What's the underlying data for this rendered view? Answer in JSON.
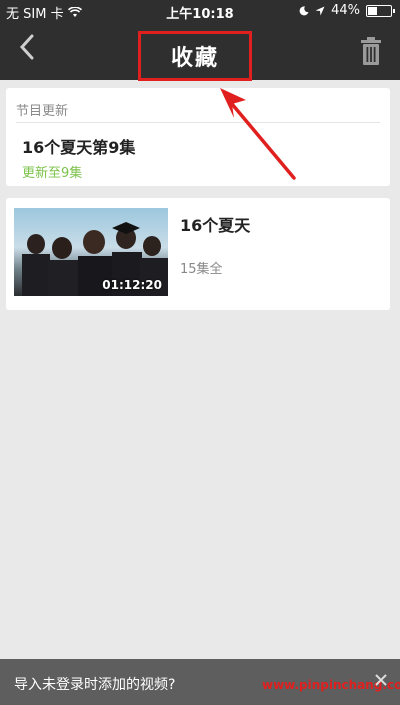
{
  "status_bar": {
    "carrier": "无 SIM 卡",
    "time": "上午10:18",
    "battery_text": "44%",
    "battery_level": 0.44
  },
  "nav": {
    "title": "收藏"
  },
  "updates": {
    "section_label": "节目更新",
    "show_title": "16个夏天第9集",
    "update_tag": "更新至9集"
  },
  "favorites": [
    {
      "title": "16个夏天",
      "episodes": "15集全",
      "duration": "01:12:20"
    }
  ],
  "bottom_bar": {
    "prompt": "导入未登录时添加的视频?",
    "watermark": "www.pinpinchang.com"
  },
  "colors": {
    "header_bg": "#2f2f2f",
    "accent_green": "#7cc24a",
    "annotation_red": "#e0201f"
  },
  "icons": {
    "back": "chevron-left-icon",
    "trash": "trash-icon",
    "wifi": "wifi-icon",
    "moon": "moon-icon",
    "location": "location-arrow-icon",
    "battery": "battery-icon"
  }
}
